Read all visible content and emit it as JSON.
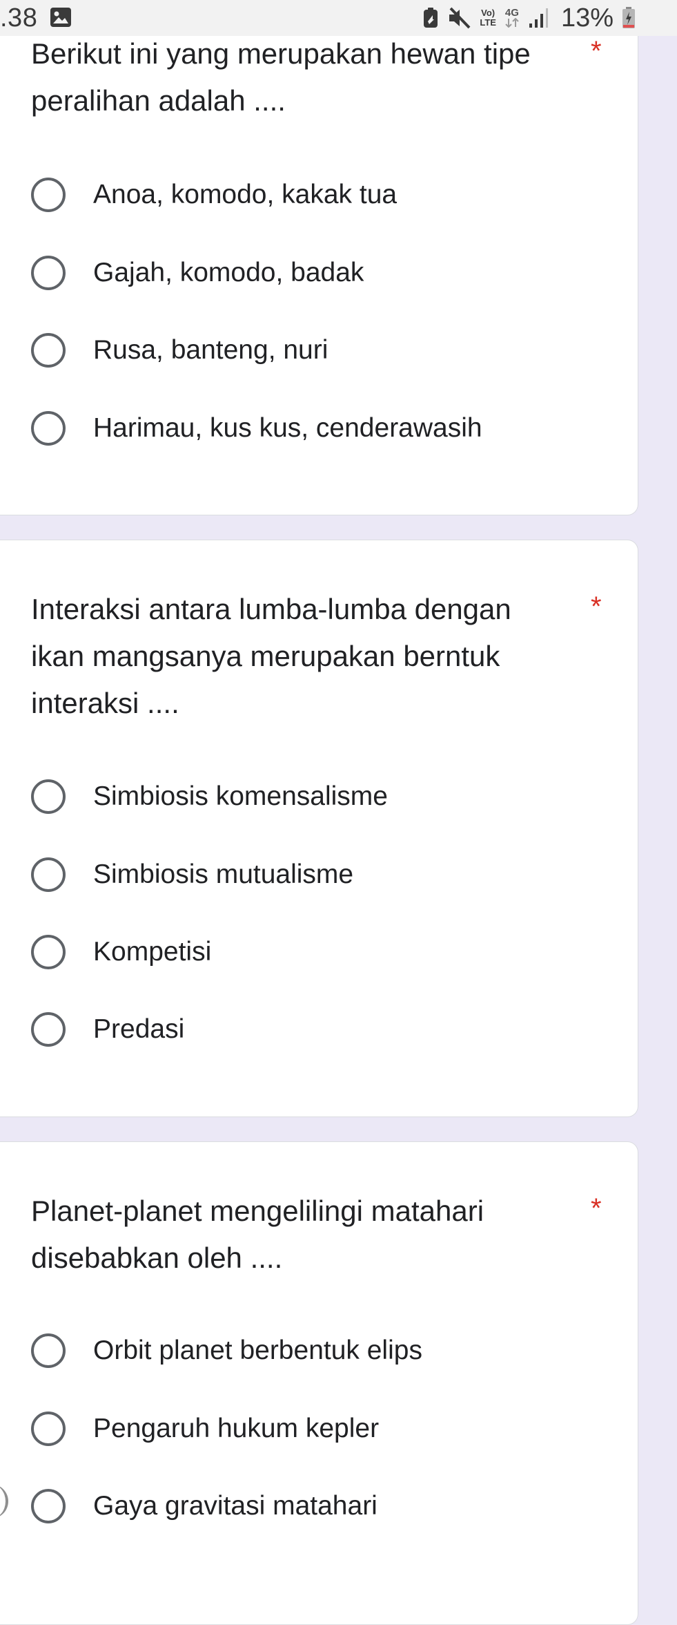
{
  "status_bar": {
    "time": ".38",
    "volte_line1": "Vo)",
    "volte_line2": "LTE",
    "network": "4G",
    "battery": "13%"
  },
  "questions": [
    {
      "lines": [
        "Berikut ini yang merupakan hewan tipe",
        "peralihan adalah ...."
      ],
      "required_mark": "*",
      "options": [
        "Anoa, komodo, kakak tua",
        "Gajah, komodo, badak",
        "Rusa, banteng, nuri",
        "Harimau, kus kus, cenderawasih"
      ]
    },
    {
      "lines": [
        "Interaksi antara lumba-lumba dengan",
        "ikan mangsanya merupakan berntuk",
        "interaksi ...."
      ],
      "required_mark": "*",
      "options": [
        "Simbiosis komensalisme",
        "Simbiosis mutualisme",
        "Kompetisi",
        "Predasi"
      ]
    },
    {
      "lines": [
        "Planet-planet mengelilingi matahari",
        "disebabkan oleh ...."
      ],
      "required_mark": "*",
      "options": [
        "Orbit planet berbentuk elips",
        "Pengaruh hukum kepler",
        "Gaya gravitasi matahari"
      ]
    }
  ],
  "colors": {
    "background": "#ebe8f6",
    "card": "#ffffff",
    "required": "#d93025",
    "radio_border": "#5f6368",
    "text": "#202124"
  }
}
